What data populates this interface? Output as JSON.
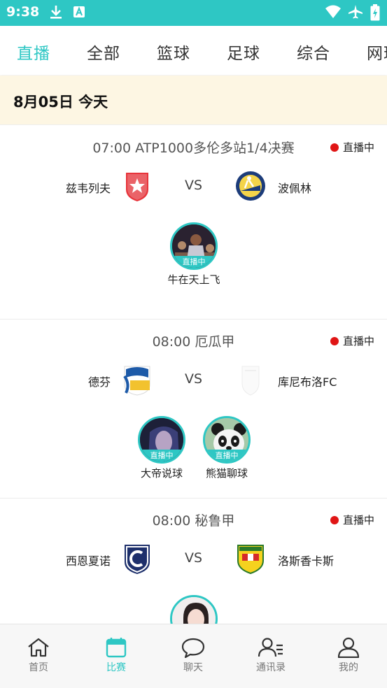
{
  "status_bar": {
    "time": "9:38"
  },
  "tabs": [
    {
      "label": "直播",
      "active": true
    },
    {
      "label": "全部"
    },
    {
      "label": "篮球"
    },
    {
      "label": "足球"
    },
    {
      "label": "综合"
    },
    {
      "label": "网球"
    }
  ],
  "date_header": "8月05日 今天",
  "matches": [
    {
      "title": "07:00 ATP1000多伦多站1/4决赛",
      "live_label": "直播中",
      "home": "兹韦列夫",
      "vs": "VS",
      "away": "波佩林",
      "anchors": [
        {
          "name": "牛在天上飞",
          "badge": "直播中"
        }
      ]
    },
    {
      "title": "08:00 厄瓜甲",
      "live_label": "直播中",
      "home": "德芬",
      "vs": "VS",
      "away": "库尼布洛FC",
      "anchors": [
        {
          "name": "大帝说球",
          "badge": "直播中"
        },
        {
          "name": "熊猫聊球",
          "badge": "直播中"
        }
      ]
    },
    {
      "title": "08:00 秘鲁甲",
      "live_label": "直播中",
      "home": "西恩夏诺",
      "vs": "VS",
      "away": "洛斯香卡斯",
      "anchors": [
        {
          "name": "",
          "badge": ""
        }
      ]
    }
  ],
  "bottom_nav": [
    {
      "label": "首页",
      "icon": "home-icon"
    },
    {
      "label": "比赛",
      "icon": "calendar-icon",
      "active": true
    },
    {
      "label": "聊天",
      "icon": "chat-bubble-icon"
    },
    {
      "label": "通讯录",
      "icon": "contacts-icon"
    },
    {
      "label": "我的",
      "icon": "user-icon"
    }
  ],
  "colors": {
    "accent": "#2ec7c4",
    "live_dot": "#e01515",
    "date_bg": "#fdf6e3"
  }
}
